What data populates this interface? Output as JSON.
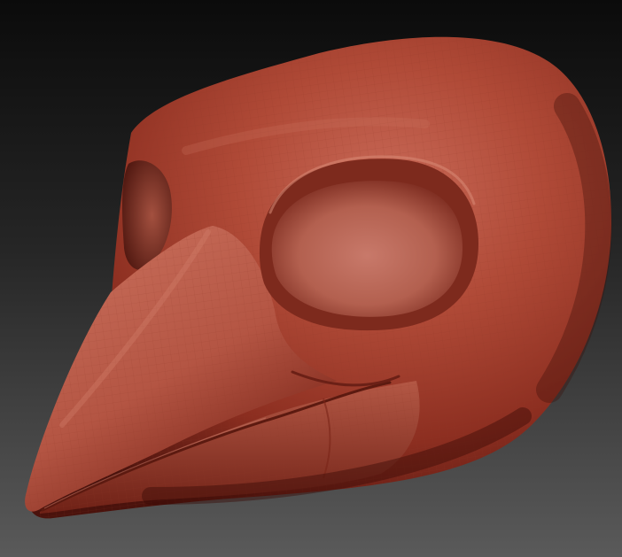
{
  "scene": {
    "subject": "bird-skull-mask-sculpt",
    "colors": {
      "background_top": "#0b0b0b",
      "background_bottom": "#5a5a5a",
      "clay_light": "#c96a58",
      "clay_mid": "#a9412f",
      "clay_dark": "#4a120c",
      "clay_shadow": "#2a0806",
      "wire": "#8f3526"
    }
  }
}
